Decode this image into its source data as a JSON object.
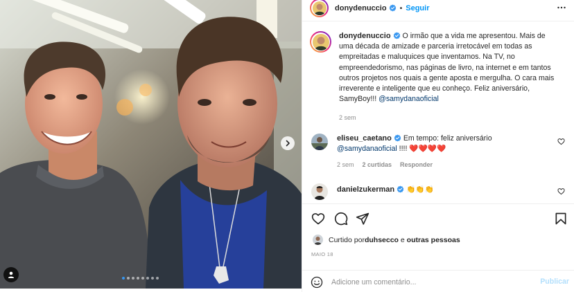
{
  "post": {
    "photo": {
      "alt_icon": "user-tag-icon",
      "next_icon": "chevron-right-icon",
      "carousel_count": 8,
      "carousel_active": 0
    },
    "header": {
      "username": "donydenuccio",
      "verified": true,
      "separator": "•",
      "follow_label": "Seguir",
      "more_icon": "more-horizontal-icon"
    },
    "caption": {
      "username": "donydenuccio",
      "text": " O irmão que a vida me apresentou. Mais de uma década de amizade e parceria irretocável em todas as empreitadas e maluquices que inventamos. Na TV, no empreendedorismo, nas páginas de livro, na internet e em tantos outros projetos nos quais a gente aposta e mergulha. O cara mais irreverente e inteligente que eu conheço. Feliz aniversário, SamyBoy!!! ",
      "mention": "@samydanaoficial",
      "time": "2 sem"
    },
    "comments": [
      {
        "username": "eliseu_caetano",
        "text_before": " Em tempo: feliz aniversário",
        "mention": "@samydanaoficial",
        "text_after": " !!!! ",
        "emoji": "❤️❤️❤️❤️",
        "time": "2 sem",
        "likes": "2 curtidas",
        "reply": "Responder"
      },
      {
        "username": "danielzukerman",
        "text": " 👏👏👏"
      }
    ],
    "actions": {
      "like_icon": "heart-icon",
      "comment_icon": "comment-icon",
      "share_icon": "paper-plane-icon",
      "save_icon": "bookmark-icon"
    },
    "likes": {
      "prefix": "Curtido por ",
      "user": "duhsecco",
      "middle": " e ",
      "others": "outras pessoas"
    },
    "date": "MAIO 18",
    "add_comment": {
      "placeholder": "Adicione um comentário...",
      "publish": "Publicar",
      "emoji_icon": "smiley-icon"
    }
  },
  "colors": {
    "accent": "#0095f6",
    "verified": "#3897f0",
    "mention": "#00376b",
    "muted": "#8e8e8e",
    "heart": "#ed4956",
    "publish_disabled": "#b2dffc"
  }
}
